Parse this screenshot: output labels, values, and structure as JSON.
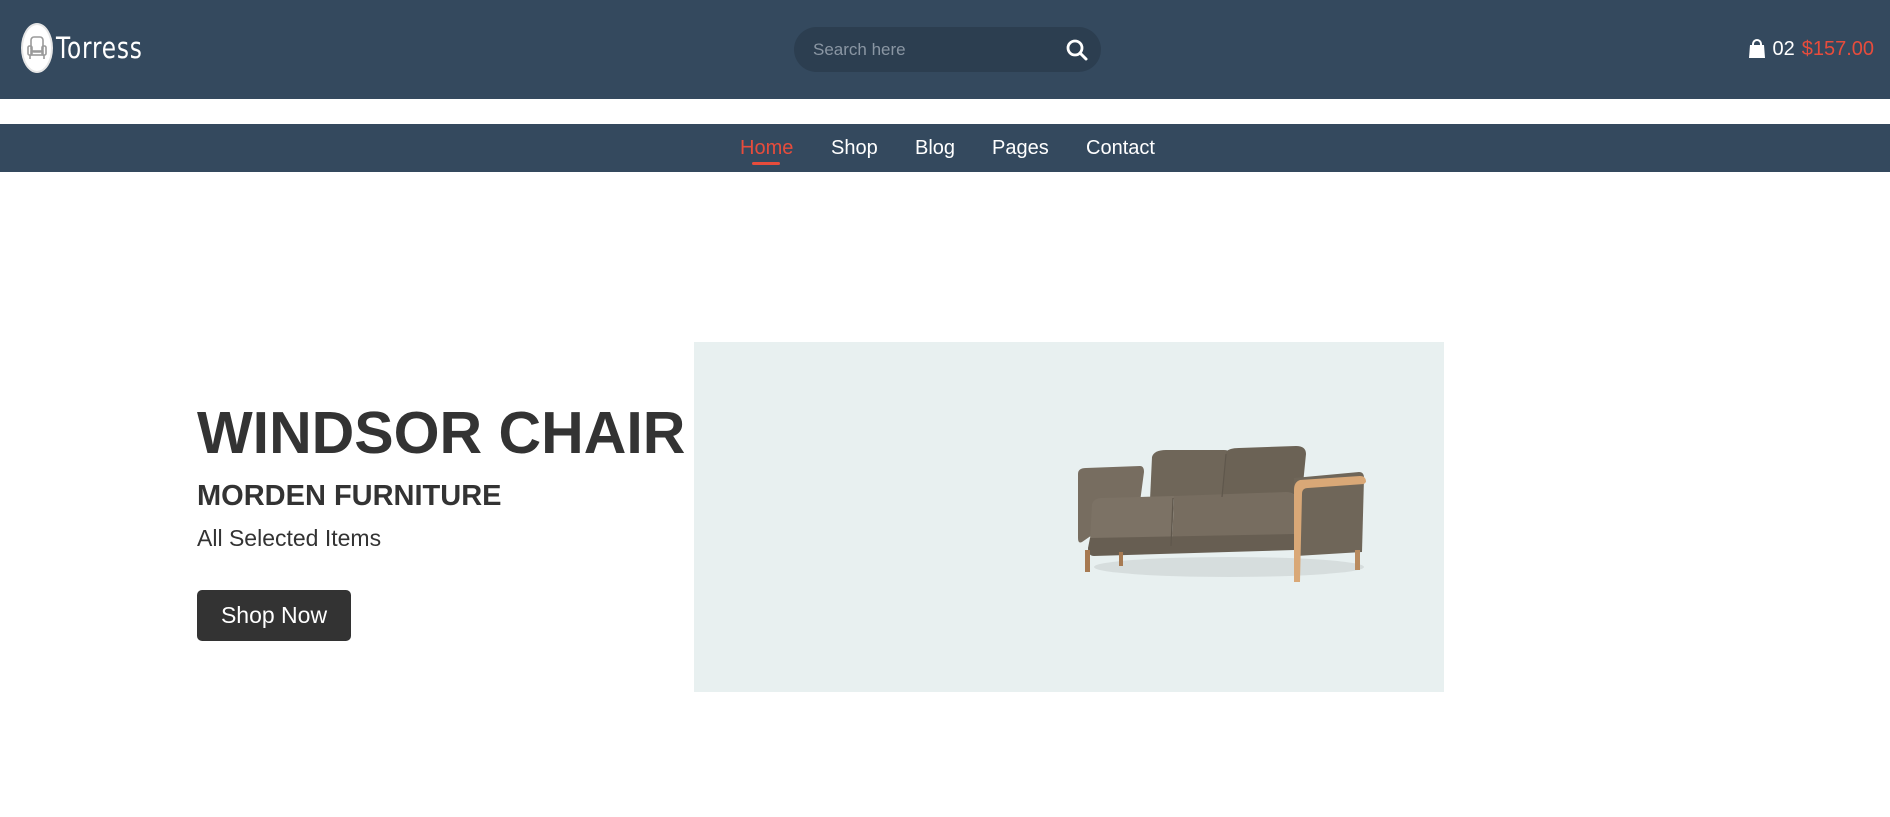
{
  "header": {
    "brand": "Torress",
    "search": {
      "placeholder": "Search here",
      "value": ""
    },
    "cart": {
      "count": "02",
      "total": "$157.00"
    }
  },
  "nav": {
    "items": [
      {
        "label": "Home",
        "active": true
      },
      {
        "label": "Shop",
        "active": false
      },
      {
        "label": "Blog",
        "active": false
      },
      {
        "label": "Pages",
        "active": false
      },
      {
        "label": "Contact",
        "active": false
      }
    ]
  },
  "hero": {
    "title": "WINDSOR CHAIR",
    "subtitle": "MORDEN FURNITURE",
    "text": "All Selected Items",
    "button_label": "Shop Now",
    "image": "sofa-image"
  },
  "colors": {
    "header_bg": "#34495e",
    "search_bg": "#2c3e50",
    "accent": "#e74c3c",
    "text_dark": "#333333",
    "hero_image_bg": "#e8f0f0",
    "button_bg": "#333333"
  },
  "icons": {
    "logo": "armchair-logo-icon",
    "search": "search-icon",
    "cart": "shopping-bag-icon"
  }
}
